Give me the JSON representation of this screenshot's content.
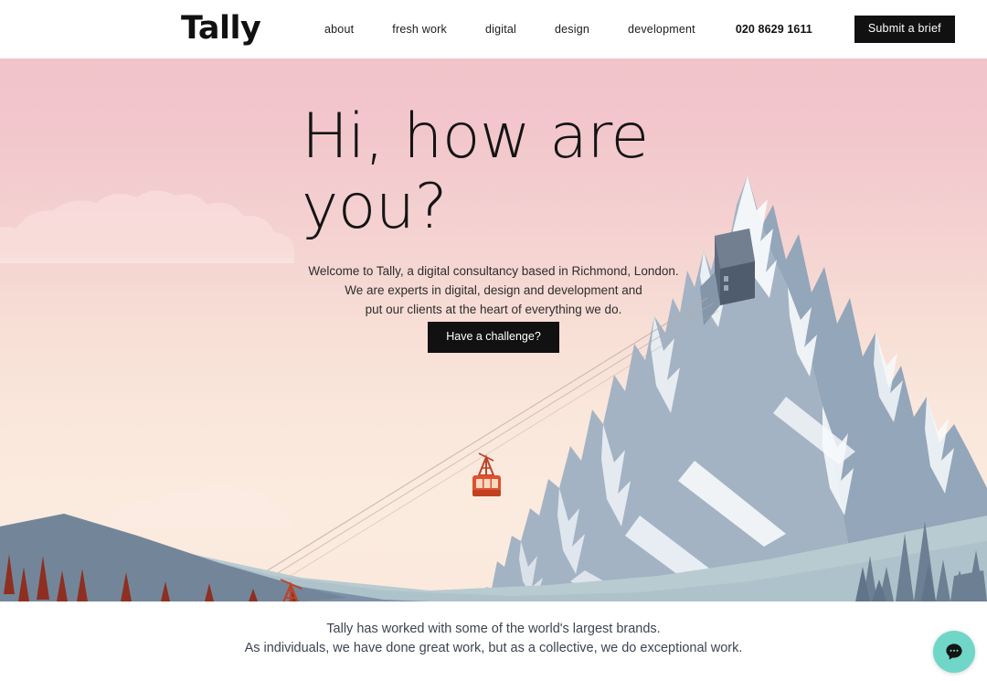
{
  "header": {
    "logo": "Tally",
    "nav": [
      {
        "id": "about",
        "label": "about"
      },
      {
        "id": "fresh-work",
        "label": "fresh work"
      },
      {
        "id": "digital",
        "label": "digital"
      },
      {
        "id": "design",
        "label": "design"
      },
      {
        "id": "development",
        "label": "development"
      }
    ],
    "phone": "020 8629 1611",
    "cta_label": "Submit a brief"
  },
  "hero": {
    "title_line1": "Hi, how are",
    "title_line2": "you?",
    "paragraph_line1": "Welcome to Tally, a digital consultancy based in Richmond, London.",
    "paragraph_line2": "We are experts in digital, design and development and",
    "paragraph_line3": "put our clients at the heart of everything we do.",
    "cta_label": "Have a challenge?"
  },
  "brands": {
    "line1": "Tally has worked with some of the world's largest brands.",
    "line2": "As individuals, we have done great work, but as a collective, we do exceptional work."
  },
  "chat": {
    "icon": "chat-bubble-icon"
  },
  "colors": {
    "dark_button": "#111111",
    "sky_top": "#f1c3ca",
    "sky_bottom": "#fbe9dd",
    "mountain": "#9fb0c2",
    "mountain_shadow": "#8da0b4",
    "snow": "#f6fafc",
    "hill_front": "#7d90a8",
    "hill_back": "#b9cdd2",
    "gondola": "#e04e28",
    "tree_red": "#8e2f22",
    "tree_blue": "#5f7286",
    "chat_bg": "#6fd6c8",
    "text_dark": "#141414",
    "brands_text": "#3d4450"
  }
}
